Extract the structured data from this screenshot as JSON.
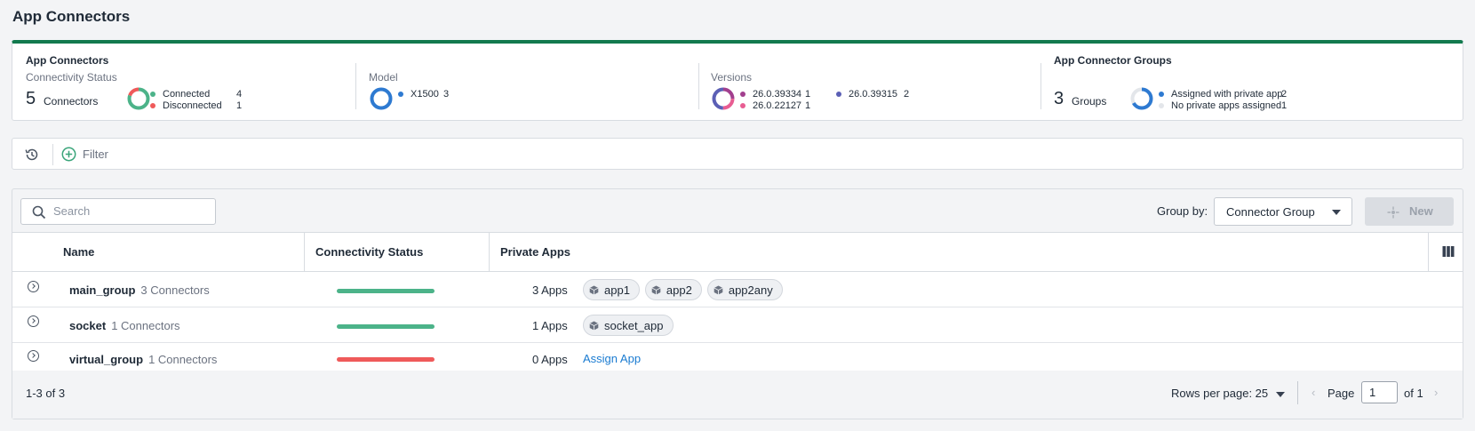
{
  "page": {
    "title": "App Connectors"
  },
  "summary": {
    "connectors": {
      "title": "App Connectors",
      "subtitle": "Connectivity Status",
      "count": "5",
      "unit": "Connectors",
      "legend": [
        {
          "label": "Connected",
          "value": "4",
          "color": "#4cb389"
        },
        {
          "label": "Disconnected",
          "value": "1",
          "color": "#ef5a5a"
        }
      ]
    },
    "model": {
      "subtitle": "Model",
      "legend": [
        {
          "label": "X1500",
          "value": "3",
          "color": "#2e7ad1"
        }
      ]
    },
    "versions": {
      "subtitle": "Versions",
      "legend": [
        {
          "label": "26.0.39334",
          "value": "1",
          "color": "#a23f8e"
        },
        {
          "label": "26.0.22127",
          "value": "1",
          "color": "#e85d92"
        },
        {
          "label": "26.0.39315",
          "value": "2",
          "color": "#5b5fb5"
        }
      ]
    },
    "groups": {
      "title": "App Connector Groups",
      "count": "3",
      "unit": "Groups",
      "legend": [
        {
          "label": "Assigned with private app",
          "value": "2",
          "color": "#2e7ad1"
        },
        {
          "label": "No private apps assigned",
          "value": "1",
          "color": "#e3e6ea"
        }
      ]
    }
  },
  "filter": {
    "label": "Filter",
    "icons": [
      "history-icon",
      "add-filter-icon"
    ]
  },
  "toolbar": {
    "search_placeholder": "Search",
    "group_by_label": "Group by:",
    "group_by_value": "Connector Group",
    "new_label": "New"
  },
  "table": {
    "columns": [
      "Name",
      "Connectivity Status",
      "Private Apps"
    ],
    "rows": [
      {
        "name": "main_group",
        "connectors": "3 Connectors",
        "status_color": "#4cb389",
        "apps_count": "3 Apps",
        "apps": [
          "app1",
          "app2",
          "app2any"
        ],
        "assign": ""
      },
      {
        "name": "socket",
        "connectors": "1 Connectors",
        "status_color": "#4cb389",
        "apps_count": "1 Apps",
        "apps": [
          "socket_app"
        ],
        "assign": ""
      },
      {
        "name": "virtual_group",
        "connectors": "1 Connectors",
        "status_color": "#ef5a5a",
        "apps_count": "0 Apps",
        "apps": [],
        "assign": "Assign App"
      }
    ]
  },
  "footer": {
    "range": "1-3 of 3",
    "rows_per_page": "Rows per page: 25",
    "page_label": "Page",
    "page_value": "1",
    "of_label": "of 1"
  }
}
